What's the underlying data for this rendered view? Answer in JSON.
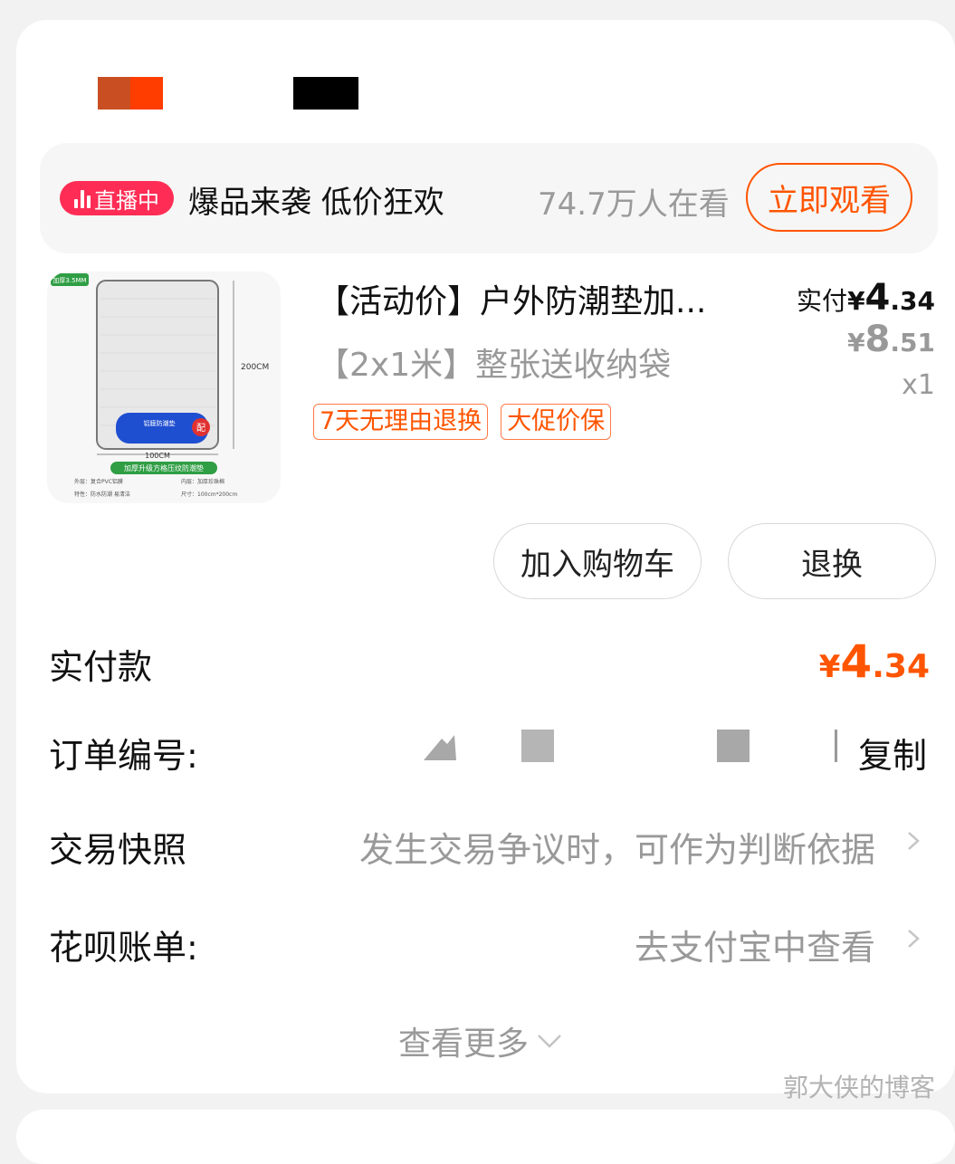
{
  "live": {
    "badge": "直播中",
    "title": "爆品来袭 低价狂欢",
    "viewers": "74.7万人在看",
    "watch_button": "立即观看"
  },
  "product": {
    "title": "【活动价】户外防潮垫加...",
    "variant": "【2x1米】整张送收纳袋",
    "tags": [
      "7天无理由退换",
      "大促价保"
    ],
    "paid_label": "实付",
    "paid_currency": "¥",
    "paid_int": "4",
    "paid_dec": ".34",
    "orig_currency": "¥",
    "orig_int": "8",
    "orig_dec": ".51",
    "quantity": "x1",
    "image": {
      "badge": "加厚3.5MM",
      "height_label": "200CM",
      "width_label": "100CM",
      "bag_label": "铝膜防潮垫",
      "bag_tag": "配",
      "banner": "加厚升级方格压纹防潮垫",
      "spec1": "外层：复合PVC铝膜",
      "spec2": "内层：加厚珍珠棉",
      "spec3": "特性：防水防潮 易清洁",
      "spec4": "尺寸：100cm*200cm"
    }
  },
  "actions": {
    "add_to_cart": "加入购物车",
    "return_exchange": "退换"
  },
  "summary": {
    "total_label": "实付款",
    "total_currency": "¥",
    "total_int": "4",
    "total_dec": ".34",
    "order_label": "订单编号:",
    "copy_label": "复制",
    "snapshot_label": "交易快照",
    "snapshot_value": "发生交易争议时，可作为判断依据",
    "huabei_label": "花呗账单:",
    "huabei_value": "去支付宝中查看",
    "view_more": "查看更多"
  },
  "watermark": "郭大侠的博客",
  "colors": {
    "accent": "#ff5500",
    "live_badge": "#ff2d55",
    "muted_text": "#999999",
    "page_bg": "#f2f2f2"
  }
}
